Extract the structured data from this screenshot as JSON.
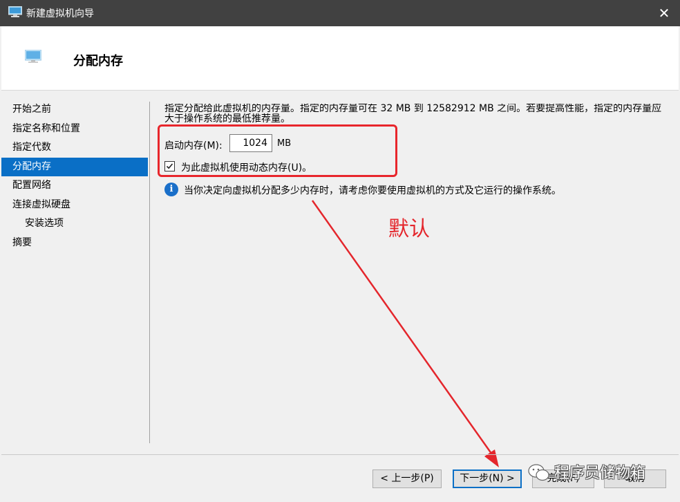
{
  "window": {
    "title": "新建虚拟机向导",
    "close_glyph": "✕"
  },
  "header": {
    "title": "分配内存"
  },
  "nav": {
    "items": [
      {
        "label": "开始之前"
      },
      {
        "label": "指定名称和位置"
      },
      {
        "label": "指定代数"
      },
      {
        "label": "分配内存"
      },
      {
        "label": "配置网络"
      },
      {
        "label": "连接虚拟硬盘"
      },
      {
        "label": "安装选项"
      },
      {
        "label": "摘要"
      }
    ],
    "active_index": 3
  },
  "content": {
    "description": "指定分配给此虚拟机的内存量。指定的内存量可在 32 MB 到 12582912 MB 之间。若要提高性能，指定的内存量应大于操作系统的最低推荐量。",
    "startup_memory_label": "启动内存(M):",
    "startup_memory_value": "1024",
    "memory_unit": "MB",
    "dynamic_memory_label": "为此虚拟机使用动态内存(U)。",
    "dynamic_memory_checked": true,
    "info_text": "当你决定向虚拟机分配多少内存时，请考虑你要使用虚拟机的方式及它运行的操作系统。"
  },
  "annotation": {
    "text": "默认",
    "color": "#e4262c"
  },
  "buttons": {
    "prev": "< 上一步(P)",
    "next": "下一步(N) >",
    "finish": "完成(F)",
    "cancel": "取消"
  },
  "watermark": {
    "text": "程序员储物箱"
  },
  "colors": {
    "titlebar": "#414141",
    "accent": "#0a6fc6",
    "annotation": "#e4262c"
  },
  "icons": {
    "app": "vm-monitor-icon",
    "info": "info-icon",
    "close": "close-icon",
    "check": "check-icon"
  }
}
